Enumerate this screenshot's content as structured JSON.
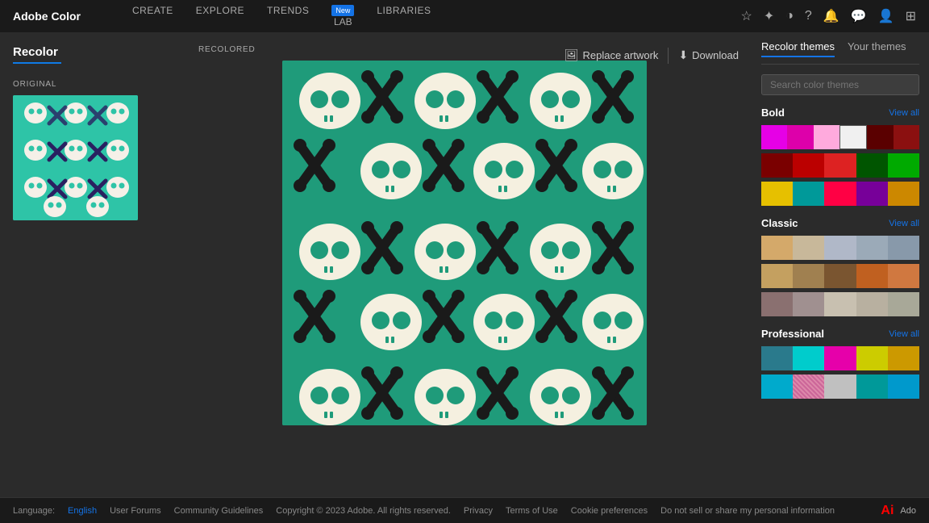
{
  "brand": "Adobe Color",
  "nav": {
    "links": [
      "CREATE",
      "EXPLORE",
      "TRENDS",
      "LAB",
      "LIBRARIES"
    ],
    "lab_badge": "New"
  },
  "toolbar": {
    "replace_label": "Replace artwork",
    "download_label": "Download"
  },
  "left": {
    "title": "Recolor",
    "original_label": "ORIGINAL"
  },
  "center": {
    "recolored_label": "RECOLORED"
  },
  "right": {
    "tab_recolor": "Recolor themes",
    "tab_yours": "Your themes",
    "search_placeholder": "Search color themes",
    "bold_label": "Bold",
    "view_all_bold": "View all",
    "classic_label": "Classic",
    "view_all_classic": "View all",
    "professional_label": "Professional",
    "view_all_professional": "View all",
    "bold_rows": [
      [
        "#e600e6",
        "#e600a0",
        "#ff80cc",
        "#ffffff",
        "#5c0000",
        "#8b0000"
      ],
      [
        "#7a0000",
        "#cc0000",
        "#dd2222",
        "#006600",
        "#00aa00"
      ],
      [
        "#e6b800",
        "#009999",
        "#ff0044",
        "#770099",
        "#cc8800"
      ]
    ],
    "classic_rows": [
      [
        "#d4a96a",
        "#c8b89a",
        "#b0b8c8",
        "#9baab8",
        "#8899aa"
      ],
      [
        "#c4a060",
        "#a08050",
        "#7a5530",
        "#c06020",
        "#d07840"
      ],
      [
        "#8a7070",
        "#a09090",
        "#c8c0b0",
        "#b8b0a0",
        "#a8a898"
      ]
    ],
    "professional_rows": [
      [
        "#2a7a8c",
        "#00cccc",
        "#e600aa",
        "#cccc00",
        "#cc9900"
      ],
      [
        "#00aacc",
        "#cc6699",
        "#cccccc",
        "#009999",
        "#0099cc"
      ]
    ]
  },
  "footer": {
    "language_label": "Language:",
    "language_value": "English",
    "links": [
      "User Forums",
      "Community Guidelines",
      "Copyright © 2023 Adobe. All rights reserved.",
      "Privacy",
      "Terms of Use",
      "Cookie preferences",
      "Do not sell or share my personal information"
    ],
    "adobe_logo": "Ado"
  }
}
